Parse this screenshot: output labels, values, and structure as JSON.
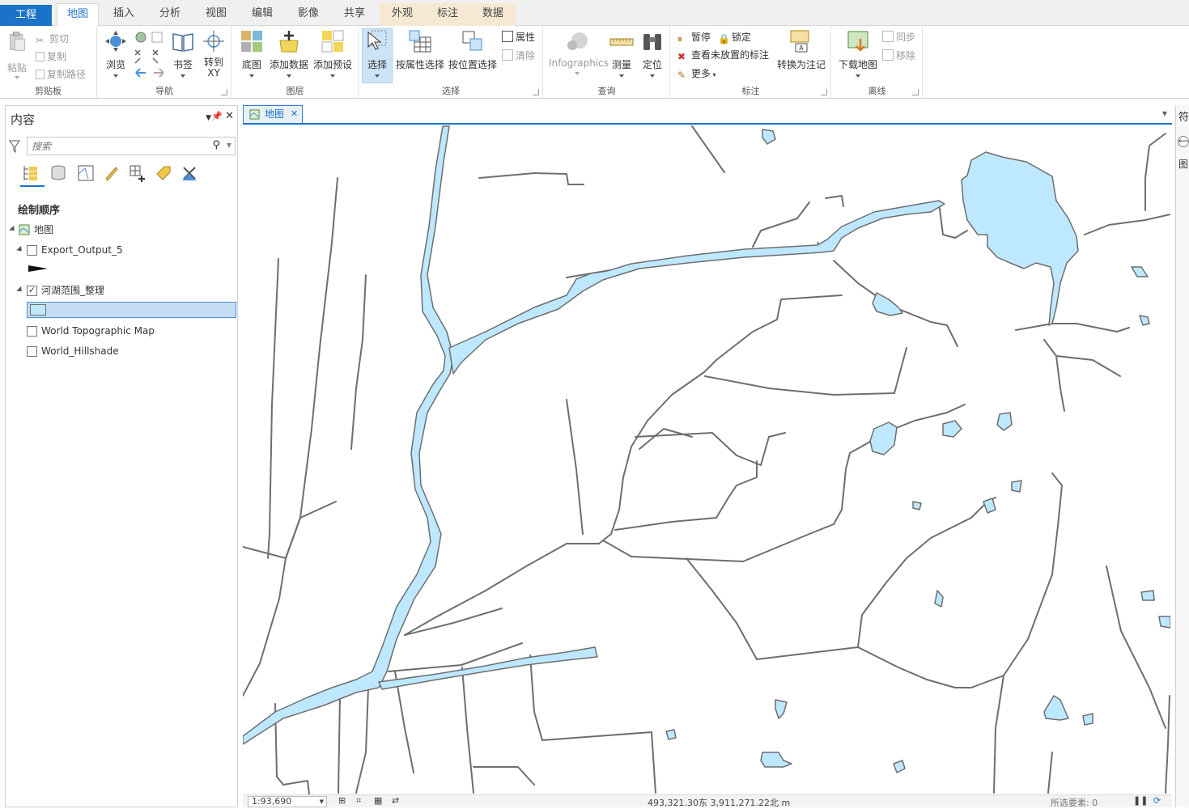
{
  "tabs": [
    {
      "label": "工程",
      "type": "file"
    },
    {
      "label": "地图",
      "type": "active"
    },
    {
      "label": "插入",
      "type": "normal"
    },
    {
      "label": "分析",
      "type": "normal"
    },
    {
      "label": "视图",
      "type": "normal"
    },
    {
      "label": "编辑",
      "type": "normal"
    },
    {
      "label": "影像",
      "type": "normal"
    },
    {
      "label": "共享",
      "type": "normal"
    },
    {
      "label": "外观",
      "type": "contextual"
    },
    {
      "label": "标注",
      "type": "contextual"
    },
    {
      "label": "数据",
      "type": "contextual"
    }
  ],
  "ribbon": {
    "clipboard": {
      "label": "剪贴板",
      "paste": "粘贴",
      "cut": "剪切",
      "copy": "复制",
      "copy_path": "复制路径"
    },
    "navigate": {
      "label": "导航",
      "explore": "浏览",
      "bookmarks": "书签",
      "goto": "转到\nXY"
    },
    "layer": {
      "label": "图层",
      "basemap": "底图",
      "add_data": "添加数据",
      "add_preset": "添加预设"
    },
    "selection": {
      "label": "选择",
      "select": "选择",
      "by_attr": "按属性选择",
      "by_loc": "按位置选择",
      "attributes": "属性",
      "clear": "清除"
    },
    "inquiry": {
      "label": "查询",
      "infographics": "Infographics",
      "measure": "测量",
      "locate": "定位"
    },
    "labeling": {
      "label": "标注",
      "pause": "暂停",
      "lock": "锁定",
      "view_unplaced": "查看未放置的标注",
      "more": "更多",
      "convert": "转换为注记"
    },
    "offline": {
      "label": "离线",
      "download": "下载地图",
      "sync": "同步",
      "remove": "移除"
    }
  },
  "contents": {
    "title": "内容",
    "search_placeholder": "搜索",
    "drawing_order": "绘制顺序",
    "layers": [
      {
        "name": "地图",
        "checked": null
      },
      {
        "name": "Export_Output_5",
        "checked": false
      },
      {
        "name": "河湖范围_整理",
        "checked": true
      },
      {
        "name": "World Topographic Map",
        "checked": false
      },
      {
        "name": "World_Hillshade",
        "checked": false
      }
    ]
  },
  "map_tab": {
    "label": "地图",
    "close": "✕"
  },
  "status": {
    "scale": "1:93,690",
    "coords": "493,321.30东 3,911,271.22北 m",
    "selected": "所选要素: 0"
  },
  "colors": {
    "water": "#bee8ff",
    "line": "#6e6e6e",
    "accent": "#1a73c7"
  },
  "right_pane": {
    "title": "符",
    "label": "图"
  }
}
